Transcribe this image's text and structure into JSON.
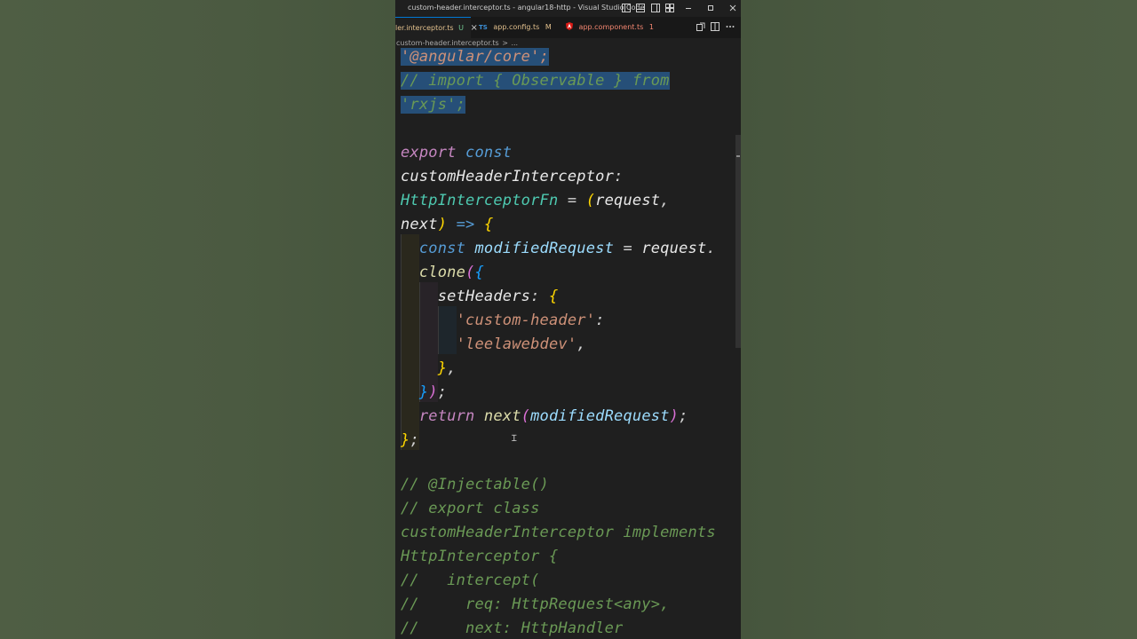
{
  "window": {
    "title": "custom-header.interceptor.ts - angular18-http - Visual Studio Code"
  },
  "tabs": [
    {
      "label": "ler.interceptor.ts",
      "status": "U",
      "active": true,
      "icon": "typescript-icon"
    },
    {
      "label": "app.config.ts",
      "status": "M",
      "active": false,
      "icon": "typescript-icon"
    },
    {
      "label": "app.component.ts",
      "status": "1",
      "active": false,
      "icon": "angular-icon"
    }
  ],
  "breadcrumb": {
    "file": "custom-header.interceptor.ts",
    "separator": ">",
    "rest": "..."
  },
  "code": [
    {
      "text": "'@angular/core';",
      "selected": true
    },
    {
      "text": "// import { Observable } from",
      "selected": true
    },
    {
      "text": "'rxjs';",
      "selected": true
    },
    {
      "text": "",
      "selected": false
    },
    {
      "text": "export const",
      "selected": false
    },
    {
      "text": "customHeaderInterceptor:",
      "selected": false
    },
    {
      "text": "HttpInterceptorFn = (request,",
      "selected": false
    },
    {
      "text": "next) => {",
      "selected": false
    },
    {
      "text": "  const modifiedRequest = request.",
      "selected": false
    },
    {
      "text": "  clone({",
      "selected": false
    },
    {
      "text": "    setHeaders: {",
      "selected": false
    },
    {
      "text": "      'custom-header':",
      "selected": false
    },
    {
      "text": "      'leelawebdev',",
      "selected": false
    },
    {
      "text": "    },",
      "selected": false
    },
    {
      "text": "  });",
      "selected": false
    },
    {
      "text": "  return next(modifiedRequest);",
      "selected": false
    },
    {
      "text": "};",
      "selected": false
    },
    {
      "text": "",
      "selected": false
    },
    {
      "text": "// @Injectable()",
      "selected": false
    },
    {
      "text": "// export class",
      "selected": false
    },
    {
      "text": "customHeaderInterceptor implements",
      "selected": false
    },
    {
      "text": "HttpInterceptor {",
      "selected": false
    },
    {
      "text": "//   intercept(",
      "selected": false
    },
    {
      "text": "//     req: HttpRequest<any>,",
      "selected": false
    },
    {
      "text": "//     next: HttpHandler",
      "selected": false
    }
  ],
  "colors": {
    "editor_bg": "#1f1f1f",
    "selection": "#264f78",
    "comment": "#6a9955",
    "keyword": "#c586c0",
    "storage": "#569cd6",
    "variable": "#9cdcfe",
    "function": "#dcdcaa",
    "type": "#4ec9b0",
    "string": "#ce9178",
    "accent": "#0078d4"
  }
}
